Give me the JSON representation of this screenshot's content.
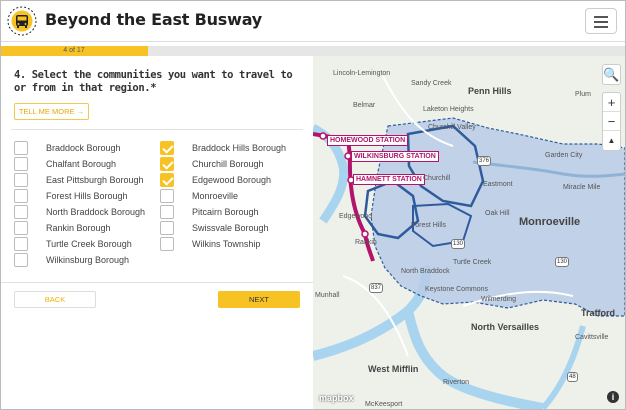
{
  "header": {
    "title": "Beyond the East Busway",
    "menu_icon": "hamburger-icon",
    "logo_icon": "bus-icon"
  },
  "progress": {
    "text": "4 of 17",
    "fraction": 0.235,
    "color": "#f7c224"
  },
  "question": {
    "text": "4. Select the communities you want to travel to or from in that region.*",
    "tell_more_label": "TELL ME MORE →"
  },
  "communities": [
    {
      "label": "Braddock Borough",
      "checked": false
    },
    {
      "label": "Braddock Hills Borough",
      "checked": true
    },
    {
      "label": "Chalfant Borough",
      "checked": false
    },
    {
      "label": "Churchill Borough",
      "checked": true
    },
    {
      "label": "East Pittsburgh Borough",
      "checked": false
    },
    {
      "label": "Edgewood Borough",
      "checked": true
    },
    {
      "label": "Forest Hills Borough",
      "checked": false
    },
    {
      "label": "Monroeville",
      "checked": false
    },
    {
      "label": "North Braddock Borough",
      "checked": false
    },
    {
      "label": "Pitcairn Borough",
      "checked": false
    },
    {
      "label": "Rankin Borough",
      "checked": false
    },
    {
      "label": "Swissvale Borough",
      "checked": false
    },
    {
      "label": "Turtle Creek Borough",
      "checked": false
    },
    {
      "label": "Wilkins Township",
      "checked": false
    },
    {
      "label": "Wilkinsburg Borough",
      "checked": false
    }
  ],
  "buttons": {
    "back_label": "BACK",
    "next_label": "NEXT"
  },
  "map": {
    "stations": [
      "HOMEWOOD STATION",
      "WILKINSBURG STATION",
      "HAMNETT STATION"
    ],
    "places": {
      "penn_hills": "Penn Hills",
      "monroeville": "Monroeville",
      "north_versailles": "North Versailles",
      "west_mifflin": "West Mifflin",
      "trafford": "Trafford",
      "churchill": "Churchill",
      "sandy_creek": "Sandy Creek",
      "lincoln_lemington": "Lincoln-Lemington",
      "belmar": "Belmar",
      "laketon_heights": "Laketon Heights",
      "churchill_valley": "Churchill Valley",
      "garden_city": "Garden City",
      "miracle_mile": "Miracle Mile",
      "eastmont": "Eastmont",
      "oak_hill": "Oak Hill",
      "forest_hills": "Forest Hills",
      "edgewood": "Edgewood",
      "rankin": "Rankin",
      "north_braddock": "North Braddock",
      "turtle_creek": "Turtle Creek",
      "munhall": "Munhall",
      "keystone_commons": "Keystone Commons",
      "wilmerding": "Wilmerding",
      "cavittsville": "Cavittsville",
      "riverton": "Riverton",
      "mckeesport": "McKeesport",
      "plum": "Plum"
    },
    "shields": [
      "376",
      "130",
      "130",
      "837",
      "48"
    ],
    "controls": {
      "search_icon": "search-icon",
      "zoom_in": "+",
      "zoom_out": "−",
      "compass": "▲"
    },
    "attribution": "mapbox",
    "region_fill": "#b9cbe6",
    "boundary_color": "#2f5b9c",
    "busway_color": "#b3136c"
  }
}
